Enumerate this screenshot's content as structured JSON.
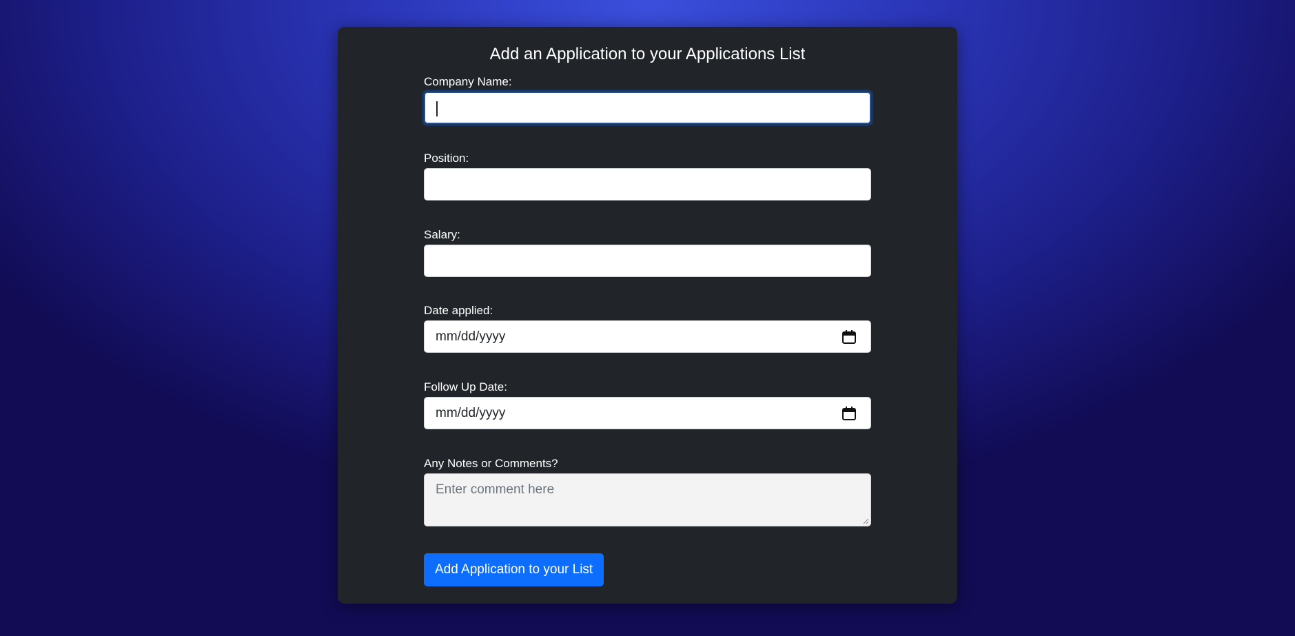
{
  "form": {
    "title": "Add an Application to your Applications List",
    "fields": {
      "company": {
        "label": "Company Name:",
        "value": ""
      },
      "position": {
        "label": "Position:",
        "value": ""
      },
      "salary": {
        "label": "Salary:",
        "value": ""
      },
      "date_applied": {
        "label": "Date applied:",
        "value": "mm/dd/yyyy"
      },
      "follow_up": {
        "label": "Follow Up Date:",
        "value": "mm/dd/yyyy"
      },
      "notes": {
        "label": "Any Notes or Comments?",
        "placeholder": "Enter comment here"
      }
    },
    "submit_label": "Add Application to your List"
  },
  "icons": {
    "date_applied_icon": "calendar-icon",
    "follow_up_icon": "calendar-icon",
    "notes_resize": "resize-handle-icon"
  },
  "colors": {
    "card_bg": "#212529",
    "button_bg": "#0d6efd",
    "focus_border": "#2a4f8f"
  }
}
